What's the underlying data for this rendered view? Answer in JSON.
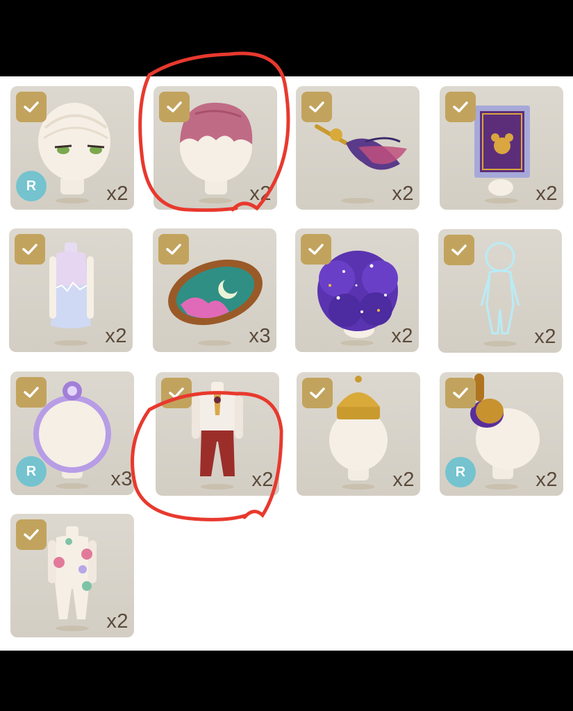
{
  "colors": {
    "background_bar": "#000000",
    "panel": "#ffffff",
    "card": "#d8d3ca",
    "check_badge": "#c2a35e",
    "rarity_badge": "#74c3cf",
    "quantity_text": "#5a4a3a",
    "annotation": "#e8392e"
  },
  "items": [
    {
      "art": "eyes-head-icon",
      "qty": "x2",
      "selected": true,
      "rarity": "R"
    },
    {
      "art": "pink-hair-icon",
      "qty": "x2",
      "selected": true,
      "rarity": ""
    },
    {
      "art": "feather-quill-icon",
      "qty": "x2",
      "selected": true,
      "rarity": ""
    },
    {
      "art": "stamp-icon",
      "qty": "x2",
      "selected": true,
      "rarity": ""
    },
    {
      "art": "pastel-dress-icon",
      "qty": "x2",
      "selected": true,
      "rarity": ""
    },
    {
      "art": "moon-mirror-icon",
      "qty": "x3",
      "selected": true,
      "rarity": ""
    },
    {
      "art": "galaxy-hair-icon",
      "qty": "x2",
      "selected": true,
      "rarity": ""
    },
    {
      "art": "glow-outline-body-icon",
      "qty": "x2",
      "selected": true,
      "rarity": ""
    },
    {
      "art": "bubble-ring-icon",
      "qty": "x3",
      "selected": true,
      "rarity": "R"
    },
    {
      "art": "red-uniform-outfit-icon",
      "qty": "x2",
      "selected": true,
      "rarity": ""
    },
    {
      "art": "golden-crown-icon",
      "qty": "x2",
      "selected": true,
      "rarity": ""
    },
    {
      "art": "ponytail-icon",
      "qty": "x2",
      "selected": true,
      "rarity": "R"
    },
    {
      "art": "pompom-bodysuit-icon",
      "qty": "x2",
      "selected": true,
      "rarity": ""
    }
  ]
}
